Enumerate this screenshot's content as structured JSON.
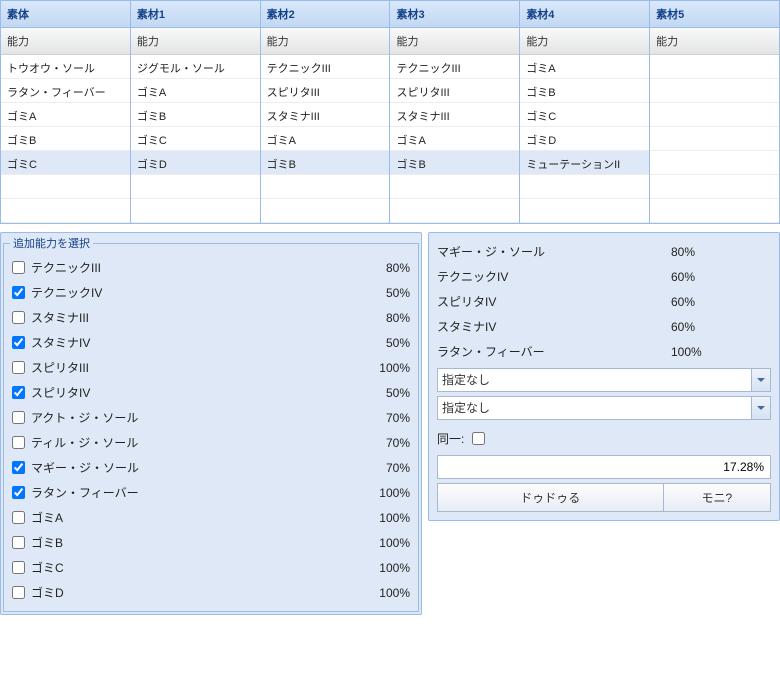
{
  "grids": {
    "columns": [
      {
        "header": "素体",
        "sub": "能力",
        "rows": [
          "トウオウ・ソール",
          "ラタン・フィーバー",
          "ゴミA",
          "ゴミB",
          "ゴミC",
          "",
          ""
        ],
        "selected": 4
      },
      {
        "header": "素材1",
        "sub": "能力",
        "rows": [
          "ジグモル・ソール",
          "ゴミA",
          "ゴミB",
          "ゴミC",
          "ゴミD",
          "",
          ""
        ],
        "selected": 4
      },
      {
        "header": "素材2",
        "sub": "能力",
        "rows": [
          "テクニックIII",
          "スピリタIII",
          "スタミナIII",
          "ゴミA",
          "ゴミB",
          "",
          ""
        ],
        "selected": 4
      },
      {
        "header": "素材3",
        "sub": "能力",
        "rows": [
          "テクニックIII",
          "スピリタIII",
          "スタミナIII",
          "ゴミA",
          "ゴミB",
          "",
          ""
        ],
        "selected": 4
      },
      {
        "header": "素材4",
        "sub": "能力",
        "rows": [
          "ゴミA",
          "ゴミB",
          "ゴミC",
          "ゴミD",
          "ミューテーションII",
          "",
          ""
        ],
        "selected": 4
      },
      {
        "header": "素材5",
        "sub": "能力",
        "rows": [
          "",
          "",
          "",
          "",
          "",
          "",
          ""
        ],
        "selected": -1
      }
    ]
  },
  "ability_panel": {
    "legend": "追加能力を選択",
    "items": [
      {
        "name": "テクニックIII",
        "pct": "80%",
        "checked": false
      },
      {
        "name": "テクニックIV",
        "pct": "50%",
        "checked": true
      },
      {
        "name": "スタミナIII",
        "pct": "80%",
        "checked": false
      },
      {
        "name": "スタミナIV",
        "pct": "50%",
        "checked": true
      },
      {
        "name": "スピリタIII",
        "pct": "100%",
        "checked": false
      },
      {
        "name": "スピリタIV",
        "pct": "50%",
        "checked": true
      },
      {
        "name": "アクト・ジ・ソール",
        "pct": "70%",
        "checked": false
      },
      {
        "name": "ティル・ジ・ソール",
        "pct": "70%",
        "checked": false
      },
      {
        "name": "マギー・ジ・ソール",
        "pct": "70%",
        "checked": true
      },
      {
        "name": "ラタン・フィーバー",
        "pct": "100%",
        "checked": true
      },
      {
        "name": "ゴミA",
        "pct": "100%",
        "checked": false
      },
      {
        "name": "ゴミB",
        "pct": "100%",
        "checked": false
      },
      {
        "name": "ゴミC",
        "pct": "100%",
        "checked": false
      },
      {
        "name": "ゴミD",
        "pct": "100%",
        "checked": false
      }
    ]
  },
  "summary": {
    "items": [
      {
        "name": "マギー・ジ・ソール",
        "pct": "80%"
      },
      {
        "name": "テクニックIV",
        "pct": "60%"
      },
      {
        "name": "スピリタIV",
        "pct": "60%"
      },
      {
        "name": "スタミナIV",
        "pct": "60%"
      },
      {
        "name": "ラタン・フィーバー",
        "pct": "100%"
      }
    ],
    "select1_value": "指定なし",
    "select2_value": "指定なし",
    "same_label": "同一:",
    "same_checked": false,
    "total_pct": "17.28%",
    "btn1": "ドゥドゥる",
    "btn2": "モニ?"
  }
}
